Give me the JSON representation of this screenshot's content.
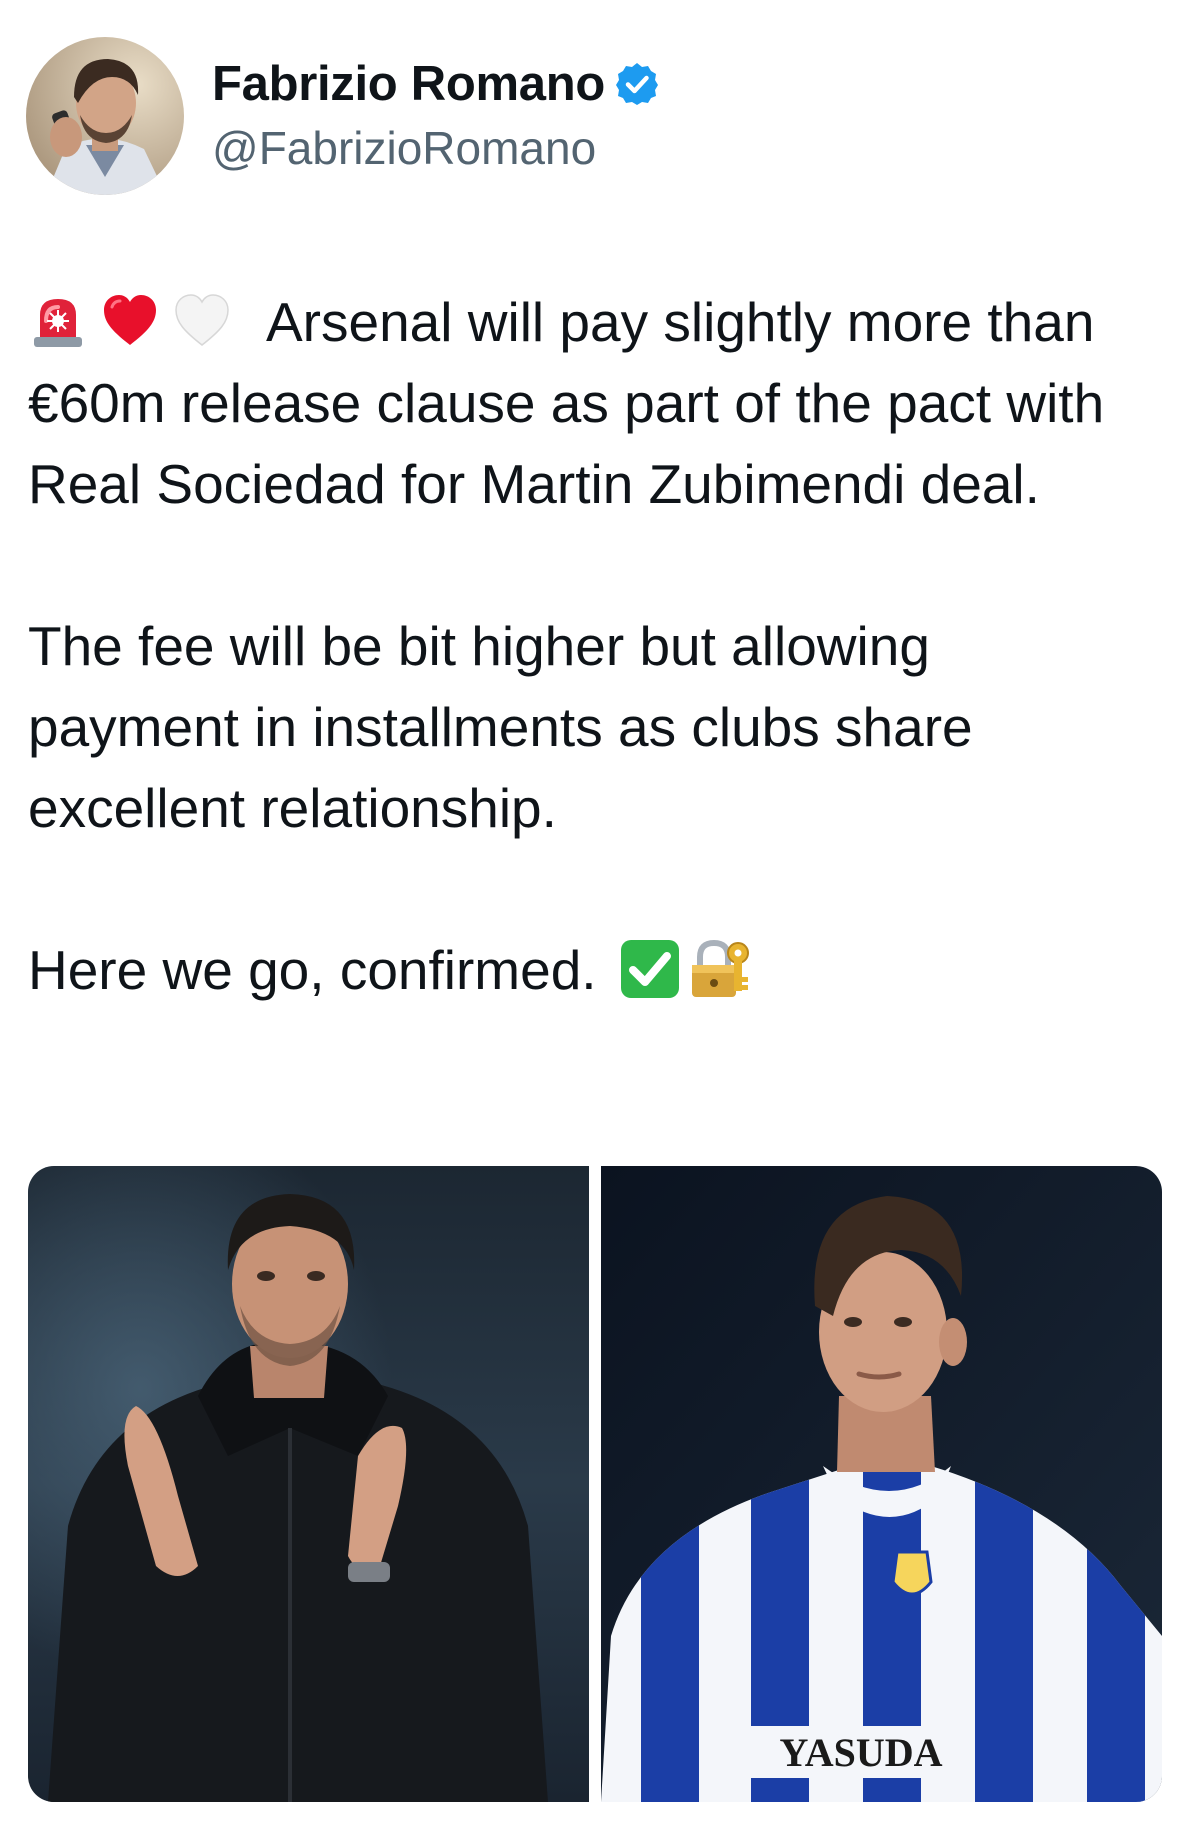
{
  "author": {
    "display_name": "Fabrizio Romano",
    "handle": "@FabrizioRomano",
    "verified": true,
    "verified_badge_color": "#1d9bf0",
    "avatar_icon": "profile-photo-avatar"
  },
  "tweet": {
    "lead_emojis": [
      "rotating-light-icon",
      "red-heart-icon",
      "white-heart-icon"
    ],
    "paragraph_1": "Arsenal will pay slightly more than €60m release clause as part of the pact with Real Sociedad for Martin Zubimendi deal.",
    "paragraph_2": "The fee will be bit higher but allowing payment in installments as clubs share excellent relationship.",
    "paragraph_3": "Here we go, confirmed.",
    "trailing_emojis": [
      "check-mark-button-icon",
      "locked-with-key-icon"
    ]
  },
  "media": {
    "photos": [
      {
        "name": "photo-coach-applauding"
      },
      {
        "name": "photo-player-real-sociedad-kit"
      }
    ],
    "kit_sponsor_text": "YASUDA"
  },
  "colors": {
    "text": "#0f1419",
    "secondary_text": "#536471",
    "accent": "#1d9bf0"
  }
}
